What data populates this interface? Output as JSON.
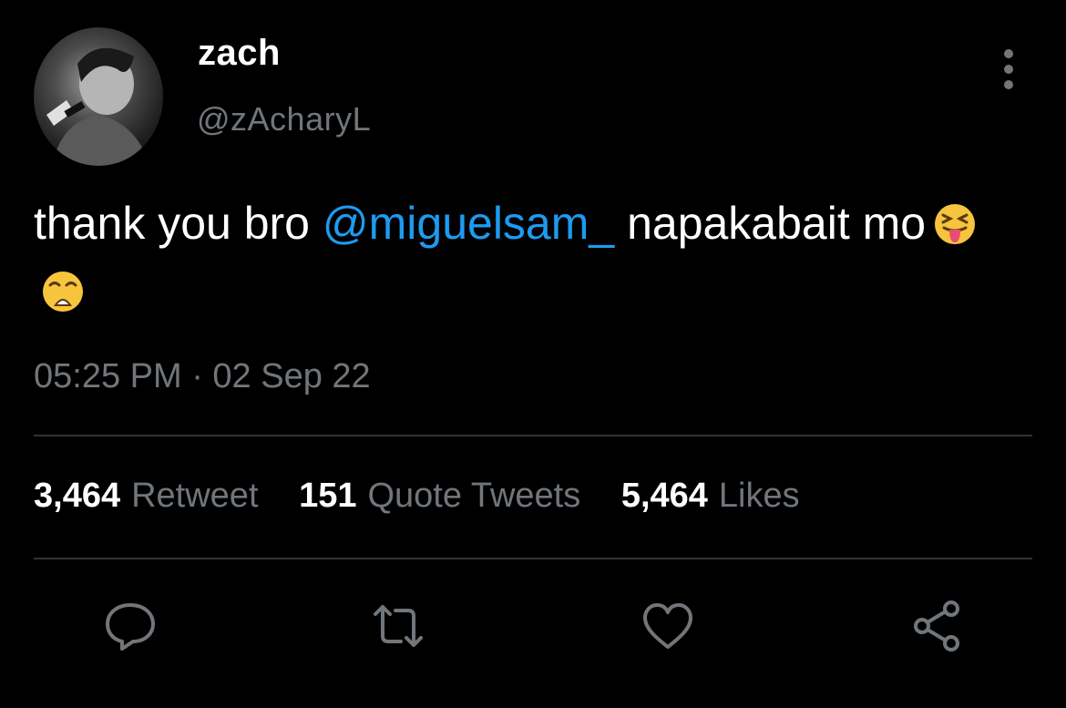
{
  "author": {
    "display_name": "zach",
    "handle": "@zAcharyL"
  },
  "tweet": {
    "text_before": "thank you bro ",
    "mention": "@miguelsam_",
    "text_after": " napakabait mo",
    "emojis": [
      "squinting-face-with-tongue",
      "weary-face"
    ]
  },
  "timestamp": "05:25 PM · 02 Sep 22",
  "stats": {
    "retweets_count": "3,464",
    "retweets_label": "Retweet",
    "quotes_count": "151",
    "quotes_label": "Quote Tweets",
    "likes_count": "5,464",
    "likes_label": "Likes"
  },
  "actions": [
    "reply-icon",
    "retweet-icon",
    "like-icon",
    "share-icon"
  ],
  "colors": {
    "background": "#000000",
    "accent": "#1d9bf0",
    "muted": "#71767b",
    "divider": "#2f3336"
  }
}
